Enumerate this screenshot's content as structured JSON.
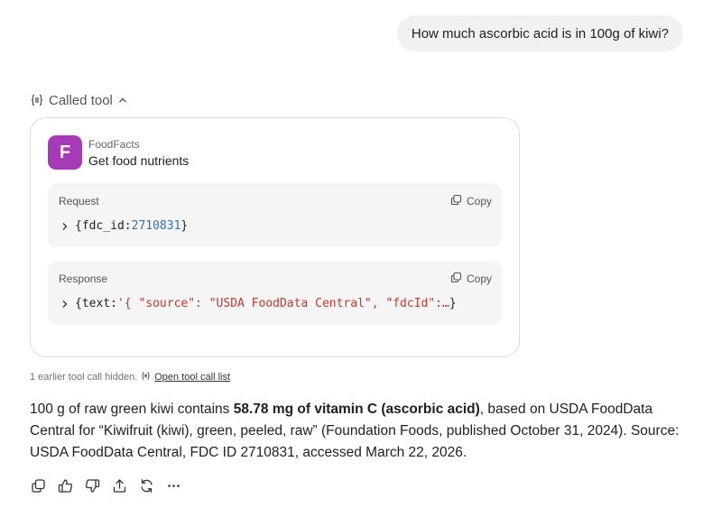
{
  "user_message": "How much ascorbic acid is in 100g of kiwi?",
  "called_tool": {
    "label": "Called tool",
    "icon": "tool-braces-icon",
    "expanded_icon": "chevron-up-icon"
  },
  "tool_card": {
    "app_logo_letter": "F",
    "app_name": "FoodFacts",
    "action": "Get food nutrients",
    "brand_color": "#a63bb8",
    "request": {
      "label": "Request",
      "copy_label": "Copy",
      "code_prefix": "{fdc_id: ",
      "code_value": "2710831",
      "code_suffix": "}"
    },
    "response": {
      "label": "Response",
      "copy_label": "Copy",
      "code_prefix": "{text: ",
      "code_value": "'{ \"source\": \"USDA FoodData Central\", \"fdcId\":…",
      "code_suffix": " }"
    }
  },
  "hidden_note": {
    "text": "1 earlier tool call hidden.",
    "link": "Open tool call list"
  },
  "answer": {
    "part1": "100 g of raw green kiwi contains ",
    "bold": "58.78 mg of vitamin C (ascorbic acid)",
    "part2": ", based on USDA FoodData Central for “Kiwifruit (kiwi), green, peeled, raw” (Foundation Foods, published October 31, 2024). Source: USDA FoodData Central, FDC ID 2710831, accessed March 22, 2026."
  },
  "actions": [
    "copy-icon",
    "thumbs-up-icon",
    "thumbs-down-icon",
    "share-icon",
    "regenerate-icon",
    "more-icon"
  ]
}
